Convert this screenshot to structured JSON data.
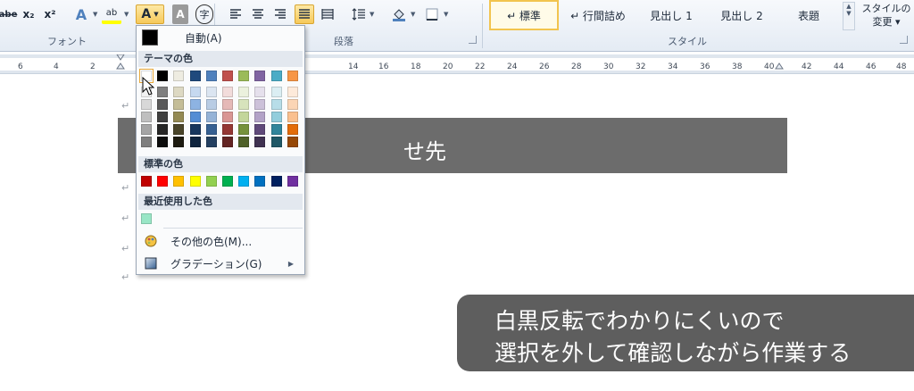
{
  "ribbon": {
    "font_group": {
      "label": "フォント",
      "buttons": {
        "strike": "abe",
        "subscript": "x₂",
        "superscript": "x²",
        "text_effect": "A",
        "highlight": "ab",
        "font_color": "A",
        "char_shading": "A",
        "enclose": "字"
      }
    },
    "para_group": {
      "label": "段落"
    },
    "style_group": {
      "label": "スタイル",
      "styles": [
        "↵ 標準",
        "↵ 行間詰め",
        "見出し 1",
        "見出し 2",
        "表題"
      ],
      "change_line1": "スタイルの",
      "change_line2": "変更 ▾"
    }
  },
  "ruler": {
    "left_numbers": [
      "6",
      "4",
      "2"
    ],
    "right_numbers": [
      "14",
      "16",
      "18",
      "20",
      "22",
      "24",
      "26",
      "28",
      "30",
      "32",
      "34",
      "36",
      "38",
      "40",
      "42",
      "44",
      "46",
      "48"
    ]
  },
  "document": {
    "banner_text": "せ先",
    "paragraph_mark": "↵"
  },
  "palette": {
    "auto_label": "自動(A)",
    "theme_header": "テーマの色",
    "standard_header": "標準の色",
    "recent_header": "最近使用した色",
    "more_colors": "その他の色(M)...",
    "gradient": "グラデーション(G)",
    "theme_top": [
      "#ffffff",
      "#000000",
      "#eeece1",
      "#1f497d",
      "#4f81bd",
      "#c0504d",
      "#9bbb59",
      "#8064a2",
      "#4bacc6",
      "#f79646"
    ],
    "theme_shades": [
      [
        "#f2f2f2",
        "#d8d8d8",
        "#bfbfbf",
        "#a5a5a5",
        "#7f7f7f"
      ],
      [
        "#7f7f7f",
        "#595959",
        "#3f3f3f",
        "#262626",
        "#0c0c0c"
      ],
      [
        "#ddd9c3",
        "#c4bd97",
        "#938953",
        "#494429",
        "#1d1b10"
      ],
      [
        "#c6d9f0",
        "#8db3e2",
        "#548dd4",
        "#17365d",
        "#0f243e"
      ],
      [
        "#dbe5f1",
        "#b8cce4",
        "#95b3d7",
        "#366092",
        "#244061"
      ],
      [
        "#f2dcdb",
        "#e5b9b7",
        "#d99694",
        "#953734",
        "#632423"
      ],
      [
        "#ebf1dd",
        "#d7e3bc",
        "#c3d69b",
        "#76923c",
        "#4f6128"
      ],
      [
        "#e5e0ec",
        "#ccc1d9",
        "#b2a2c7",
        "#5f497a",
        "#3f3151"
      ],
      [
        "#dbeef3",
        "#b7dde8",
        "#92cddc",
        "#31859b",
        "#205867"
      ],
      [
        "#fdeada",
        "#fbd5b5",
        "#fac08f",
        "#e36c09",
        "#974806"
      ]
    ],
    "standard": [
      "#c00000",
      "#ff0000",
      "#ffc000",
      "#ffff00",
      "#92d050",
      "#00b050",
      "#00b0f0",
      "#0070c0",
      "#002060",
      "#7030a0"
    ],
    "recent": [
      "#99e6c6"
    ]
  },
  "caption": {
    "line1": "白黒反転でわかりにくいので",
    "line2": "選択を外して確認しながら作業する"
  }
}
